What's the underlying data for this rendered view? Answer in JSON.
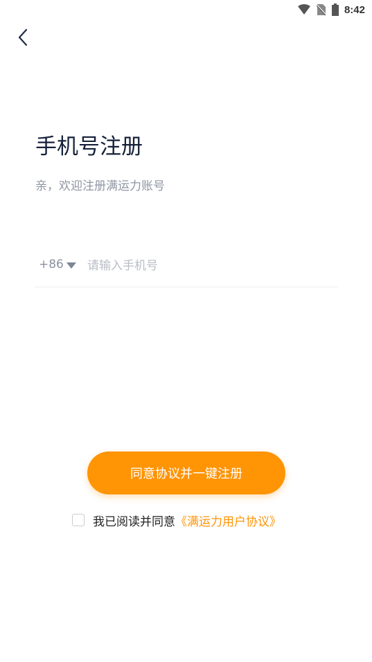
{
  "status_bar": {
    "time": "8:42"
  },
  "page": {
    "title": "手机号注册",
    "subtitle": "亲，欢迎注册满运力账号"
  },
  "phone": {
    "country_code": "+86",
    "placeholder": "请输入手机号",
    "value": ""
  },
  "register_button": {
    "label": "同意协议并一键注册"
  },
  "agreement": {
    "checked": false,
    "text": "我已阅读并同意",
    "link": "《满运力用户协议》"
  },
  "colors": {
    "accent": "#ff9405",
    "title": "#16213a",
    "muted": "#8f95a3"
  }
}
